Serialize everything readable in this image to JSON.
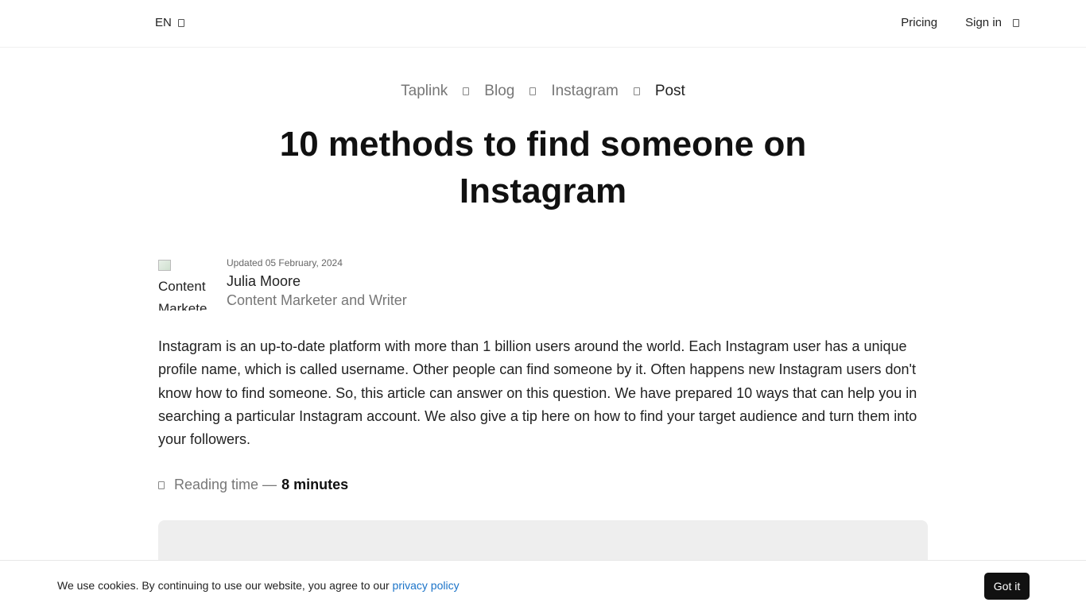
{
  "header": {
    "language": "EN",
    "language_icon": "chevron-down-icon",
    "pricing": "Pricing",
    "sign_in": "Sign in",
    "sign_in_icon": "sign-in-icon"
  },
  "breadcrumb": [
    "Taplink",
    "Blog",
    "Instagram",
    "Post"
  ],
  "article": {
    "title": "10 methods to find someone on Instagram",
    "updated": "Updated 05 February, 2024",
    "author_name": "Julia Moore",
    "author_role": "Content Marketer and Writer",
    "avatar_alt": "Content Markete",
    "intro": "Instagram is an up-to-date platform with more than 1 billion users around the world. Each Instagram user has a unique profile name, which is called username. Other people can find someone by it. Often happens new Instagram users don't know how to find someone. So, this article can answer on this question. We have prepared 10 ways that can help you in searching a particular Instagram account. We also give a tip here on how to find your target audience and turn them into your followers.",
    "reading_label": "Reading time —",
    "reading_value": "8 minutes",
    "reading_icon": "clock-icon"
  },
  "cookie": {
    "text": "We use cookies. By continuing to use our website, you agree to our",
    "link": "privacy policy",
    "button": "Got it"
  },
  "colors": {
    "link": "#1a73c8",
    "button_bg": "#111111",
    "muted_text": "#777777",
    "media_placeholder": "#eeeeee"
  }
}
